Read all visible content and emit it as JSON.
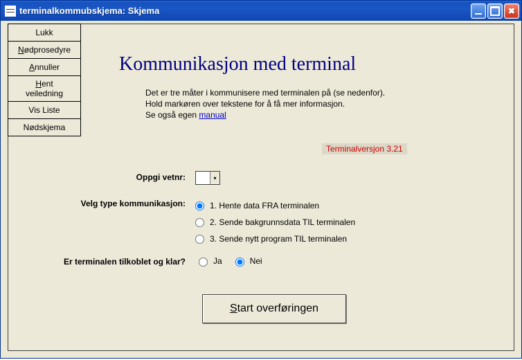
{
  "window": {
    "title": "terminalkommubskjema: Skjema"
  },
  "sidebar": {
    "items": [
      {
        "label": "Lukk"
      },
      {
        "label": "Nødprosedyre",
        "accel_index": 0
      },
      {
        "label": "Annuller",
        "accel_index": 0
      },
      {
        "label": "Hent veiledning",
        "accel_index": 0,
        "multi": true
      },
      {
        "label": "Vis Liste"
      },
      {
        "label": "Nødskjema"
      }
    ]
  },
  "heading": "Kommunikasjon med terminal",
  "description": {
    "line1": "Det er tre måter i kommunisere med terminalen på (se nedenfor).",
    "line2": "Hold markøren over tekstene for å få mer informasjon.",
    "line3_prefix": "Se også egen ",
    "link": "manual"
  },
  "version": "Terminalversjon  3.21",
  "form": {
    "vetnr_label": "Oppgi vetnr:",
    "vetnr_value": "",
    "comm_label": "Velg type kommunikasjon:",
    "comm_options": [
      "1. Hente data FRA terminalen",
      "2. Sende bakgrunnsdata TIL terminalen",
      "3. Sende nytt program TIL terminalen"
    ],
    "comm_selected": 0,
    "ready_label": "Er terminalen tilkoblet og klar?",
    "ready_yes": "Ja",
    "ready_no": "Nei",
    "ready_selected": "Nei"
  },
  "start_button": "Start overføringen"
}
